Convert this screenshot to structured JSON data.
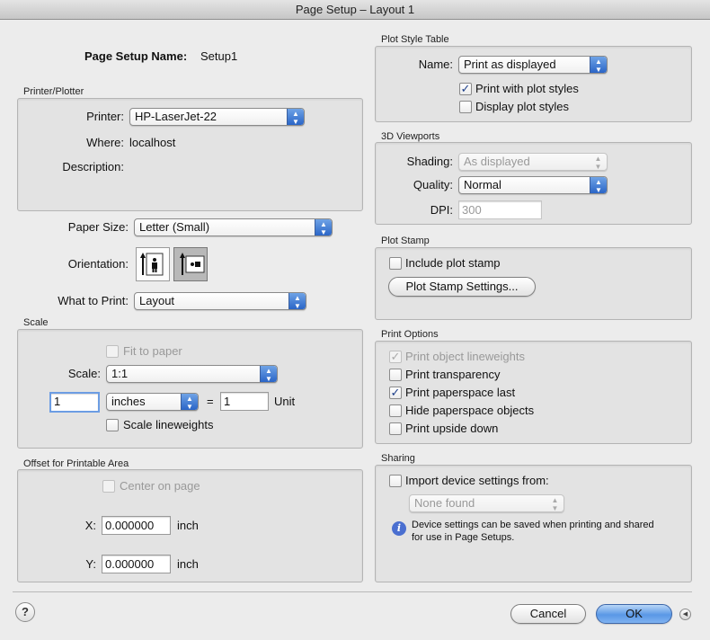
{
  "window": {
    "title": "Page Setup – Layout 1"
  },
  "setup": {
    "name_label": "Page Setup Name:",
    "name_value": "Setup1"
  },
  "printer_plotter": {
    "title": "Printer/Plotter",
    "printer_label": "Printer:",
    "printer_value": "HP-LaserJet-22",
    "where_label": "Where:",
    "where_value": "localhost",
    "description_label": "Description:"
  },
  "paper": {
    "size_label": "Paper Size:",
    "size_value": "Letter (Small)",
    "orientation_label": "Orientation:",
    "orientation_selected": "landscape",
    "what_to_print_label": "What to Print:",
    "what_to_print_value": "Layout"
  },
  "scale": {
    "title": "Scale",
    "fit_to_paper_label": "Fit to paper",
    "fit_to_paper_checked": false,
    "scale_label": "Scale:",
    "scale_value": "1:1",
    "paper_units_value": "1",
    "units_value": "inches",
    "equals": "=",
    "drawing_units_value": "1",
    "unit_label": "Unit",
    "scale_lineweights_label": "Scale lineweights",
    "scale_lineweights_checked": false
  },
  "offset": {
    "title": "Offset for Printable Area",
    "center_label": "Center on page",
    "center_checked": false,
    "x_label": "X:",
    "x_value": "0.000000",
    "x_unit": "inch",
    "y_label": "Y:",
    "y_value": "0.000000",
    "y_unit": "inch"
  },
  "plot_style_table": {
    "title": "Plot Style Table",
    "name_label": "Name:",
    "name_value": "Print as displayed",
    "print_with_styles_label": "Print with plot styles",
    "print_with_styles_checked": true,
    "display_styles_label": "Display plot styles",
    "display_styles_checked": false
  },
  "viewports_3d": {
    "title": "3D Viewports",
    "shading_label": "Shading:",
    "shading_value": "As displayed",
    "quality_label": "Quality:",
    "quality_value": "Normal",
    "dpi_label": "DPI:",
    "dpi_value": "300"
  },
  "plot_stamp": {
    "title": "Plot Stamp",
    "include_label": "Include plot stamp",
    "include_checked": false,
    "settings_button": "Plot Stamp Settings..."
  },
  "print_options": {
    "title": "Print Options",
    "items": [
      {
        "label": "Print object lineweights",
        "checked": true,
        "disabled": true
      },
      {
        "label": "Print transparency",
        "checked": false,
        "disabled": false
      },
      {
        "label": "Print paperspace last",
        "checked": true,
        "disabled": false
      },
      {
        "label": "Hide paperspace objects",
        "checked": false,
        "disabled": false
      },
      {
        "label": "Print upside down",
        "checked": false,
        "disabled": false
      }
    ]
  },
  "sharing": {
    "title": "Sharing",
    "import_label": "Import device settings from:",
    "import_checked": false,
    "source_value": "None found",
    "info_line1": "Device settings can be saved when printing and shared",
    "info_line2": "for use in Page Setups."
  },
  "footer": {
    "help": "?",
    "cancel": "Cancel",
    "ok": "OK"
  },
  "icons": {
    "checkmark": "✓",
    "popup_arrows": "▲▼",
    "info": "i",
    "disclosure": "◀"
  }
}
